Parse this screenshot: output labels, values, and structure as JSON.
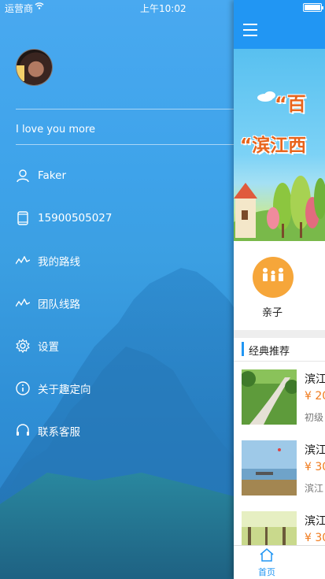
{
  "status_bar": {
    "carrier": "运营商",
    "time": "上午10:02",
    "battery_level": 1.0
  },
  "drawer": {
    "motto": "I love you more",
    "items": [
      {
        "label": "Faker",
        "icon": "user-icon"
      },
      {
        "label": "15900505027",
        "icon": "phone-icon"
      },
      {
        "label": "我的路线",
        "icon": "route-icon"
      },
      {
        "label": "团队线路",
        "icon": "team-route-icon"
      },
      {
        "label": "设置",
        "icon": "gear-icon"
      },
      {
        "label": "关于趣定向",
        "icon": "info-icon"
      },
      {
        "label": "联系客服",
        "icon": "headset-icon"
      }
    ]
  },
  "main": {
    "banner": {
      "line1": "“百",
      "line2": "“滨江西"
    },
    "category": {
      "label": "亲子",
      "color": "#f6a63a"
    },
    "section_title": "经典推荐",
    "products": [
      {
        "name": "滨江",
        "price": "¥ 20",
        "subtitle": "初级"
      },
      {
        "name": "滨江",
        "price": "¥ 30",
        "subtitle": "滨江"
      },
      {
        "name": "滨江",
        "price": "¥ 30",
        "subtitle": ""
      }
    ],
    "tab_home_label": "首页"
  },
  "colors": {
    "primary": "#2196f3",
    "price": "#f07a1c",
    "category": "#f6a63a"
  }
}
